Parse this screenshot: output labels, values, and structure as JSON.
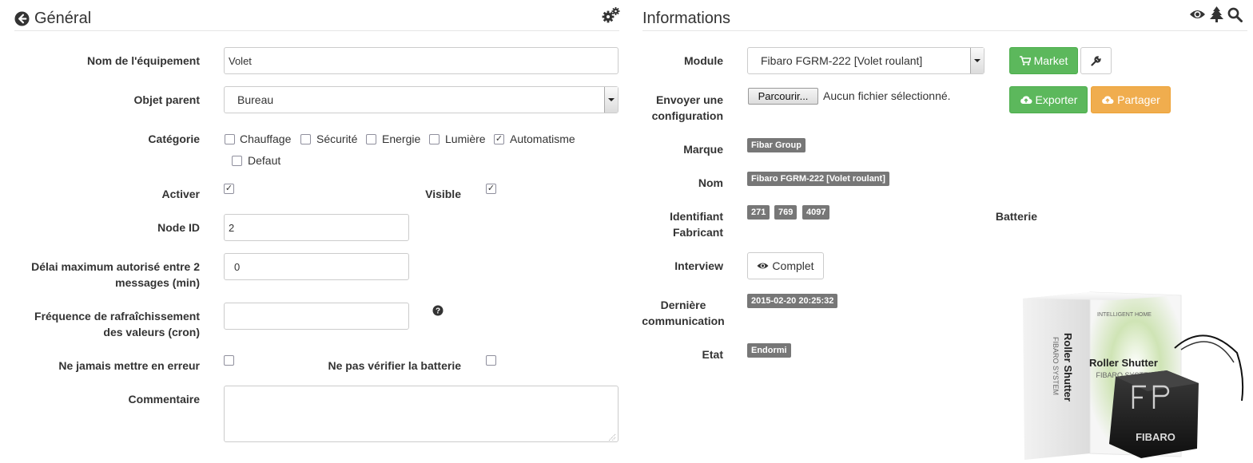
{
  "general": {
    "title": "Général",
    "icons": {
      "back": "circle-arrow-left-icon",
      "config": "cogs-icon"
    },
    "fields": {
      "name_label": "Nom de l'équipement",
      "name_value": "Volet",
      "parent_label": "Objet parent",
      "parent_value": "Bureau",
      "category_label": "Catégorie",
      "categories": [
        {
          "label": "Chauffage",
          "checked": false
        },
        {
          "label": "Sécurité",
          "checked": false
        },
        {
          "label": "Energie",
          "checked": false
        },
        {
          "label": "Lumière",
          "checked": false
        },
        {
          "label": "Automatisme",
          "checked": true
        },
        {
          "label": "Defaut",
          "checked": false
        }
      ],
      "activate_label": "Activer",
      "visible_label": "Visible",
      "node_id_label": "Node ID",
      "node_id_value": "2",
      "delay_label": "Délai maximum autorisé entre 2 messages (min)",
      "delay_value": "0",
      "refresh_label": "Fréquence de rafraîchissement des valeurs (cron)",
      "refresh_value": "",
      "never_error_label": "Ne jamais mettre en erreur",
      "no_battery_check_label": "Ne pas vérifier la batterie",
      "comment_label": "Commentaire",
      "comment_value": ""
    }
  },
  "informations": {
    "title": "Informations",
    "icons": {
      "eye": "eye-icon",
      "tree": "tree-icon",
      "search": "search-icon"
    },
    "module_label": "Module",
    "module_value": "Fibaro FGRM-222 [Volet roulant]",
    "market_button": "Market",
    "wrench_icon": "wrench-icon",
    "send_config_label": "Envoyer une configuration",
    "browse_button": "Parcourir...",
    "no_file_text": "Aucun fichier sélectionné.",
    "export_button": "Exporter",
    "share_button": "Partager",
    "brand_label": "Marque",
    "brand_value": "Fibar Group",
    "name_label": "Nom",
    "name_value": "Fibaro FGRM-222 [Volet roulant]",
    "manufacturer_id_label": "Identifiant Fabricant",
    "manufacturer_ids": [
      "271",
      "769",
      "4097"
    ],
    "battery_label": "Batterie",
    "interview_label": "Interview",
    "interview_button": "Complet",
    "last_comm_label": "Dernière communication",
    "last_comm_value": "2015-02-20 20:25:32",
    "state_label": "Etat",
    "state_value": "Endormi",
    "product_image": {
      "brand_text": "INTELLIGENT HOME",
      "side_title": "Roller Shutter",
      "side_sub": "FIBARO SYSTEM",
      "front_title": "Roller Shutter",
      "front_sub": "FIBARO SYSTEM",
      "device_logo": "FIBARO"
    }
  }
}
